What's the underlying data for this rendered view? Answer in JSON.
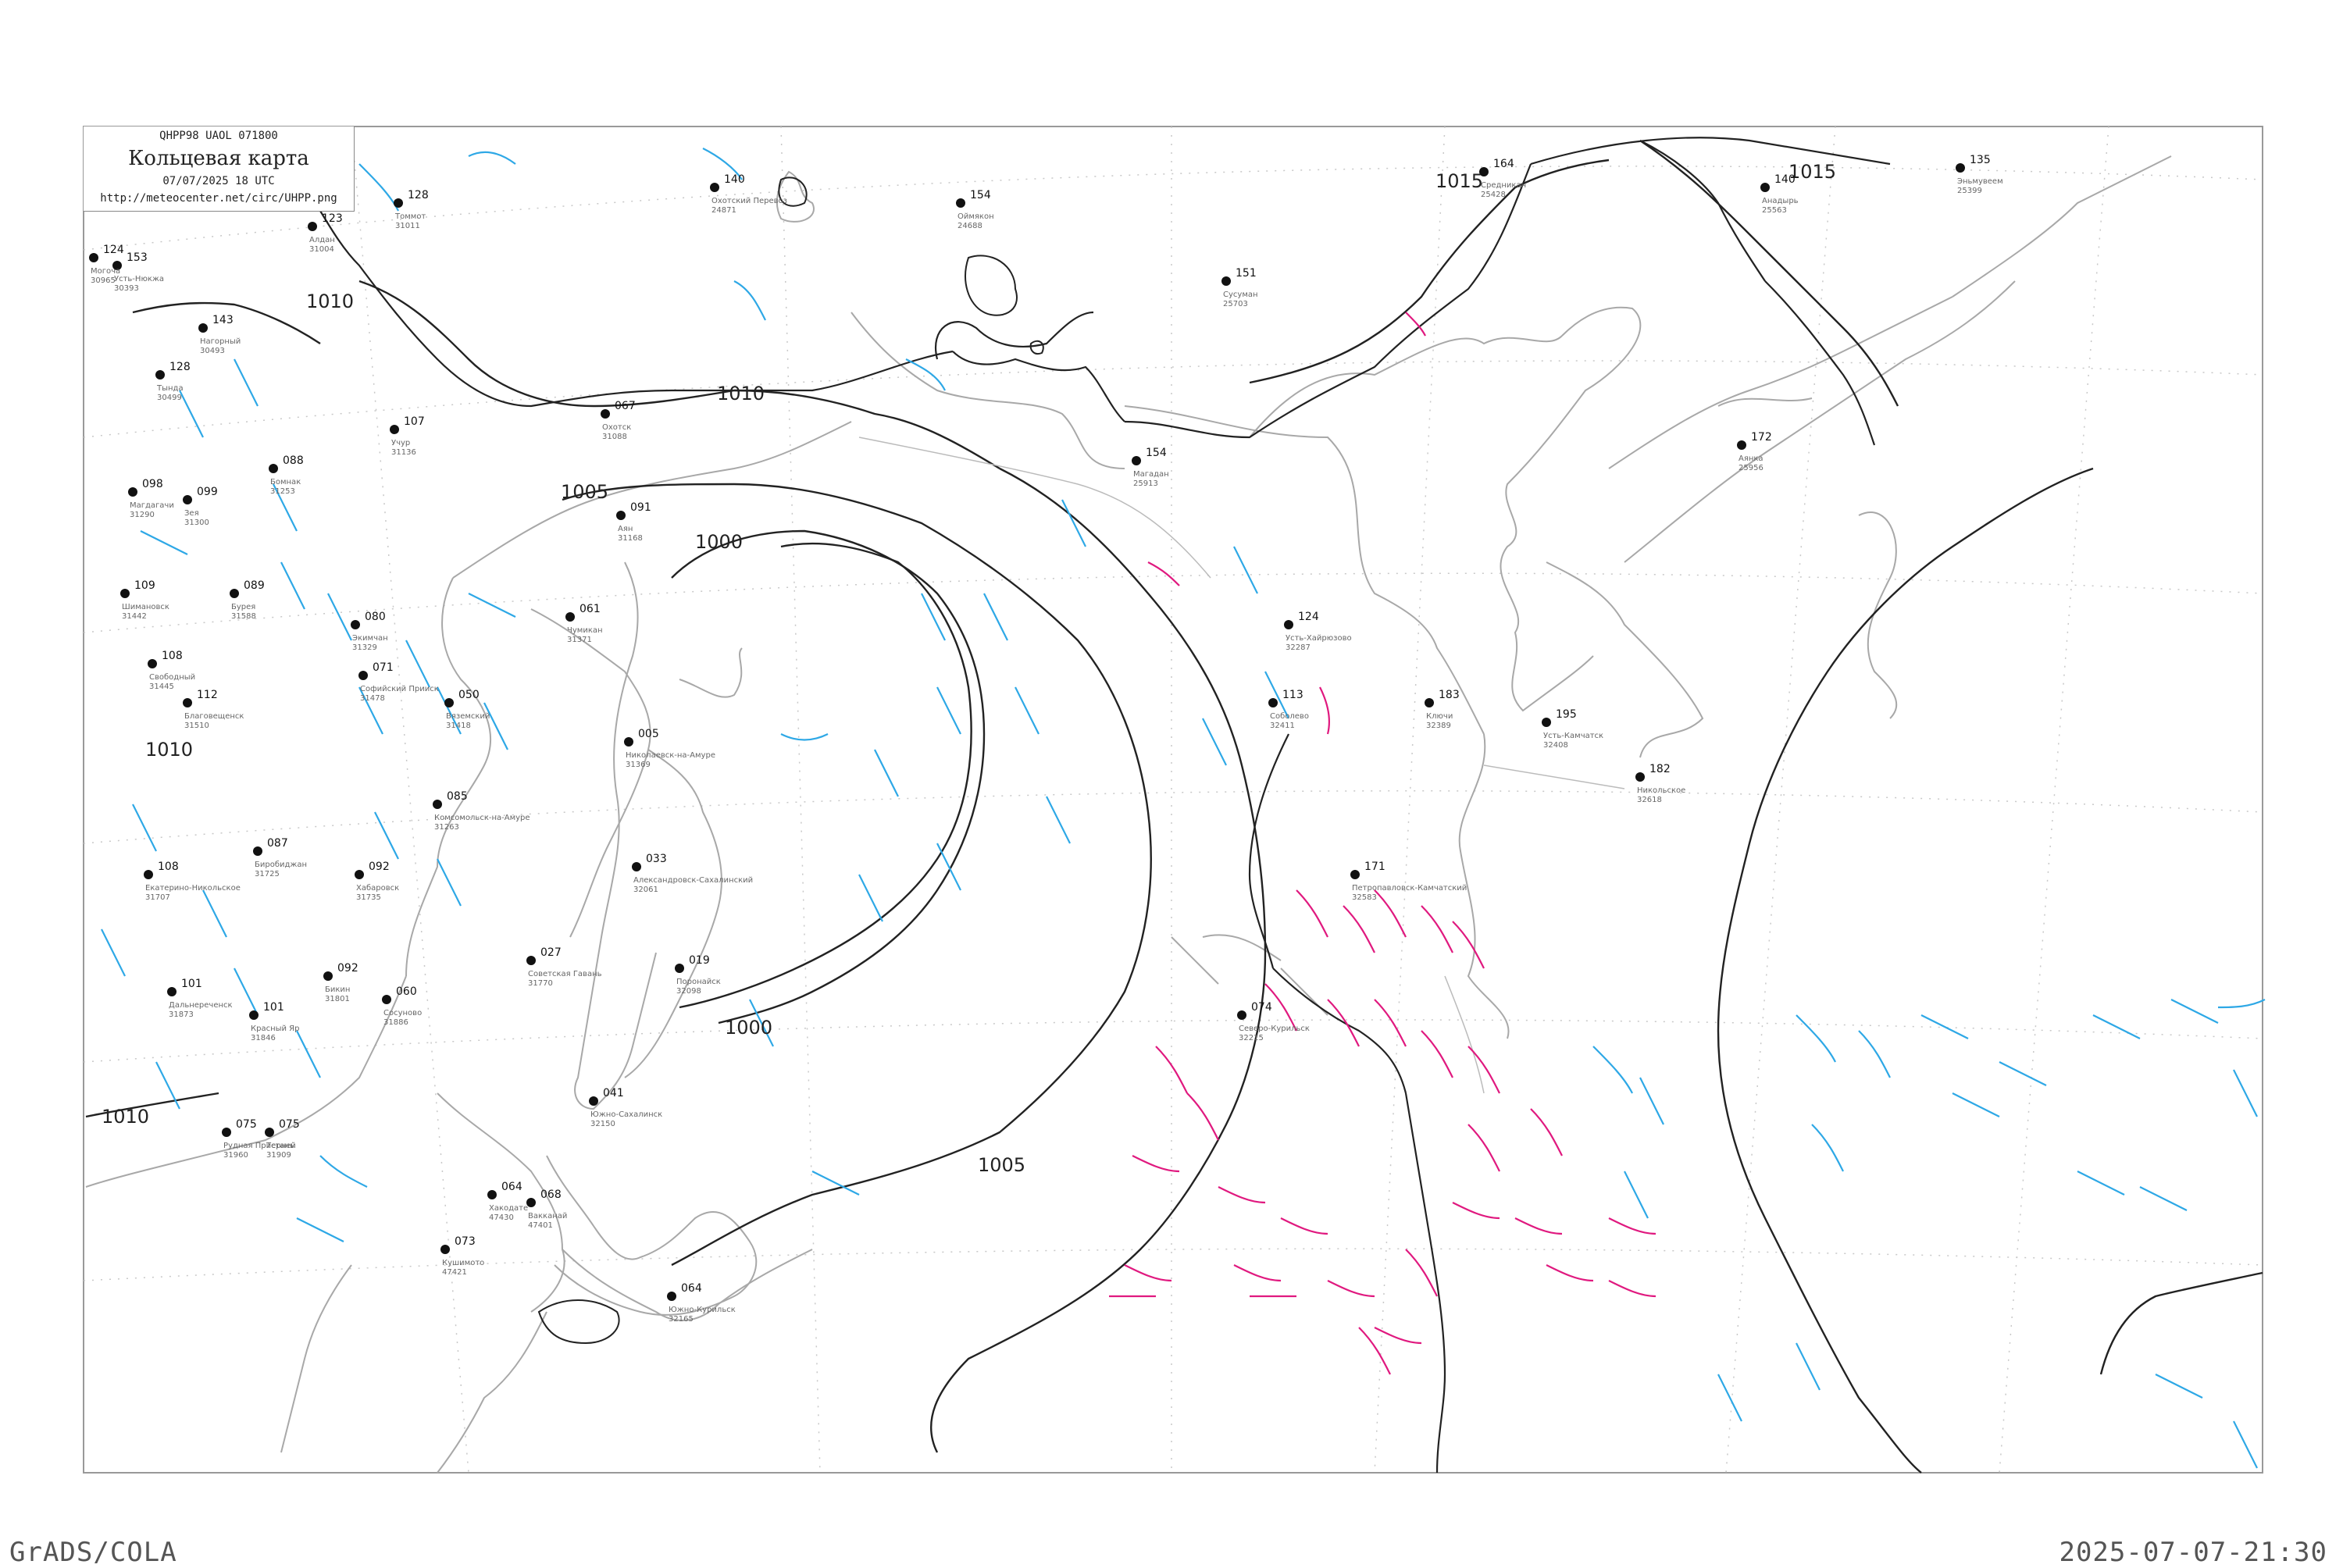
{
  "header": {
    "code_line": "QHPP98  UAOL  071800",
    "title": "Кольцевая карта",
    "datetime": "07/07/2025 18 UTC",
    "url": "http://meteocenter.net/circ/UHPP.png"
  },
  "footer": {
    "left": "GrADS/COLA",
    "right": "2025-07-07-21:30"
  },
  "isobars": [
    {
      "label": "1015"
    },
    {
      "label": "1015"
    },
    {
      "label": "1010"
    },
    {
      "label": "1010"
    },
    {
      "label": "1010"
    },
    {
      "label": "1010"
    },
    {
      "label": "1005"
    },
    {
      "label": "1005"
    },
    {
      "label": "1000"
    },
    {
      "label": "1000"
    }
  ],
  "stations": [
    {
      "name": "Усть-Нюкжа",
      "id": "30393",
      "p": "153"
    },
    {
      "name": "Могоча",
      "id": "30965",
      "p": "124"
    },
    {
      "name": "Тында",
      "id": "30499",
      "p": "128"
    },
    {
      "name": "Нагорный",
      "id": "30493",
      "p": "143"
    },
    {
      "name": "Магдагачи",
      "id": "31290",
      "p": "098"
    },
    {
      "name": "Зея",
      "id": "31300",
      "p": "099"
    },
    {
      "name": "Шимановск",
      "id": "31442",
      "p": "109"
    },
    {
      "name": "Свободный",
      "id": "31445",
      "p": "108"
    },
    {
      "name": "Благовещенск",
      "id": "31510",
      "p": "112"
    },
    {
      "name": "Екатерино-Никольское",
      "id": "31707",
      "p": "108"
    },
    {
      "name": "Биробиджан",
      "id": "31725",
      "p": "087"
    },
    {
      "name": "Хабаровск",
      "id": "31735",
      "p": "092"
    },
    {
      "name": "Бикин",
      "id": "31801",
      "p": "092"
    },
    {
      "name": "Дальнереченск",
      "id": "31873",
      "p": "101"
    },
    {
      "name": "Красный Яр",
      "id": "31846",
      "p": "101"
    },
    {
      "name": "Сосуново",
      "id": "31886",
      "p": "060"
    },
    {
      "name": "Рудная Пристань",
      "id": "31960",
      "p": "075"
    },
    {
      "name": "Терней",
      "id": "31909",
      "p": "075"
    },
    {
      "name": "Алдан",
      "id": "31004",
      "p": "123"
    },
    {
      "name": "Томмот",
      "id": "31011",
      "p": "128"
    },
    {
      "name": "Учур",
      "id": "31136",
      "p": "107"
    },
    {
      "name": "Бомнак",
      "id": "31253",
      "p": "088"
    },
    {
      "name": "Экимчан",
      "id": "31329",
      "p": "080"
    },
    {
      "name": "Софийский Прииск",
      "id": "31478",
      "p": "071"
    },
    {
      "name": "Бурея",
      "id": "31588",
      "p": "089"
    },
    {
      "name": "Вяземский",
      "id": "31418",
      "p": "050"
    },
    {
      "name": "Чумикан",
      "id": "31371",
      "p": "061"
    },
    {
      "name": "Аян",
      "id": "31168",
      "p": "091"
    },
    {
      "name": "Охотск",
      "id": "31088",
      "p": "067"
    },
    {
      "name": "Николаевск-на-Амуре",
      "id": "31369",
      "p": "005"
    },
    {
      "name": "Комсомольск-на-Амуре",
      "id": "31263",
      "p": "085"
    },
    {
      "name": "Советская Гавань",
      "id": "31770",
      "p": "027"
    },
    {
      "name": "Александровск-Сахалинский",
      "id": "32061",
      "p": "033"
    },
    {
      "name": "Поронайск",
      "id": "32098",
      "p": "019"
    },
    {
      "name": "Южно-Сахалинск",
      "id": "32150",
      "p": "041"
    },
    {
      "name": "Магадан",
      "id": "25913",
      "p": "154"
    },
    {
      "name": "Охотский Перевоз",
      "id": "24871",
      "p": "140"
    },
    {
      "name": "Оймякон",
      "id": "24688",
      "p": "154"
    },
    {
      "name": "Сусуман",
      "id": "25703",
      "p": "151"
    },
    {
      "name": "Средникан",
      "id": "25428",
      "p": "164"
    },
    {
      "name": "Анадырь",
      "id": "25563",
      "p": "140"
    },
    {
      "name": "Эньмувеем",
      "id": "25399",
      "p": "135"
    },
    {
      "name": "Аянка",
      "id": "25956",
      "p": "172"
    },
    {
      "name": "Усть-Хайрюзово",
      "id": "32287",
      "p": "124"
    },
    {
      "name": "Ключи",
      "id": "32389",
      "p": "183"
    },
    {
      "name": "Усть-Камчатск",
      "id": "32408",
      "p": "195"
    },
    {
      "name": "Петропавловск-Камчатский",
      "id": "32583",
      "p": "171"
    },
    {
      "name": "Соболево",
      "id": "32411",
      "p": "113"
    },
    {
      "name": "Никольское",
      "id": "32618",
      "p": "182"
    },
    {
      "name": "Северо-Курильск",
      "id": "32215",
      "p": "074"
    },
    {
      "name": "Хакодате",
      "id": "47430",
      "p": "064"
    },
    {
      "name": "Вакканай",
      "id": "47401",
      "p": "068"
    },
    {
      "name": "Южно-Курильск",
      "id": "32165",
      "p": "064"
    },
    {
      "name": "Кушимото",
      "id": "47421",
      "p": "073"
    }
  ]
}
